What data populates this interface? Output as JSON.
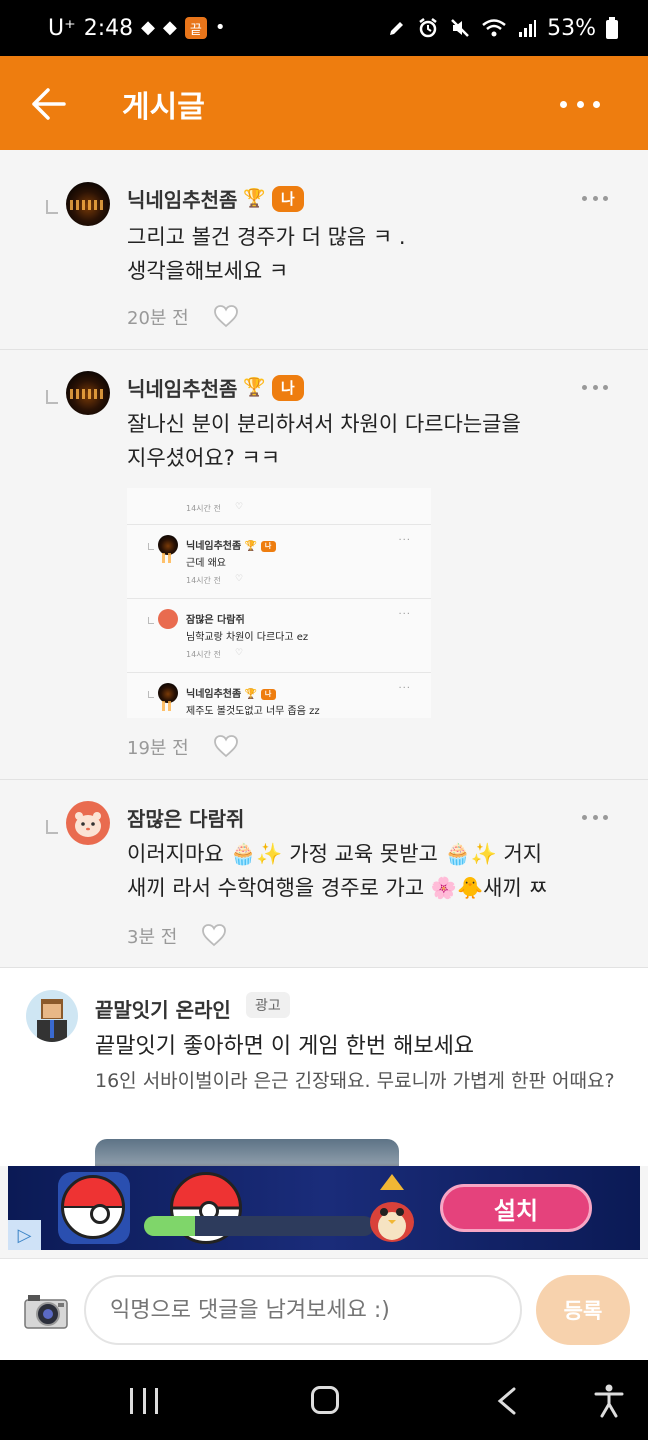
{
  "status_bar": {
    "carrier": "U⁺",
    "time": "2:48",
    "battery": "53%",
    "app_badge": "끝"
  },
  "header": {
    "title": "게시글"
  },
  "comments": [
    {
      "nickname": "닉네임추천좀",
      "badge": "나",
      "text_lines": [
        "그리고 볼건 경주가 더 많음 ㅋ .",
        "생각을해보세요 ㅋ"
      ],
      "time": "20분 전"
    },
    {
      "nickname": "닉네임추천좀",
      "badge": "나",
      "text_lines": [
        "잘나신 분이 분리하셔서 차원이 다르다는글을",
        "지우셨어요? ㅋㅋ"
      ],
      "time": "19분 전",
      "embedded_screenshot": {
        "rows": [
          {
            "time": "14시간 전"
          },
          {
            "nickname": "닉네임추천좀",
            "badge": "나",
            "text": "근데 왜요",
            "time": "14시간 전"
          },
          {
            "nickname": "잠많은 다람쥐",
            "text": "님학교랑 차원이 다르다고 ez",
            "time": "14시간 전"
          },
          {
            "nickname": "닉네임추천좀",
            "badge": "나",
            "text": "제주도 볼것도없고 너무 좁음 zz"
          }
        ]
      }
    },
    {
      "nickname": "잠많은 다람쥐",
      "text_lines": [
        "이러지마요 🧁✨ 가정 교육 못받고 🧁✨ 거지",
        "새끼 라서 수학여행을 경주로 가고 🌸🐥새끼 ㅉ"
      ],
      "time": "3분 전"
    }
  ],
  "ad_post": {
    "name": "끝말잇기 온라인",
    "label": "광고",
    "title": "끝말잇기 좋아하면 이 게임 한번 해보세요",
    "description": "16인 서바이벌이라 은근 긴장돼요. 무료니까 가볍게 한판 어때요?"
  },
  "banner_ad": {
    "install_label": "설치",
    "progress": 0.22
  },
  "comment_input": {
    "placeholder": "익명으로 댓글을 남겨보세요 :)",
    "submit_label": "등록"
  },
  "colors": {
    "accent": "#ee7d0f",
    "submit_disabled": "#f7d2ad"
  }
}
